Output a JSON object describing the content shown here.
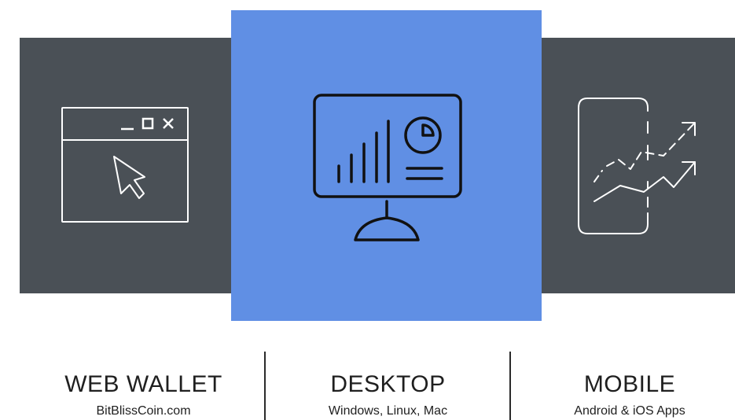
{
  "colors": {
    "dark_panel": "#4a5056",
    "accent_panel": "#608fe4",
    "icon_light": "#ffffff",
    "icon_dark": "#111111",
    "text": "#1f1f1f"
  },
  "platforms": [
    {
      "id": "web",
      "title": "WEB WALLET",
      "subtitle": "BitBlissCoin.com",
      "icon": "browser-window-cursor-icon"
    },
    {
      "id": "desktop",
      "title": "DESKTOP",
      "subtitle": "Windows, Linux, Mac",
      "icon": "monitor-analytics-icon"
    },
    {
      "id": "mobile",
      "title": "MOBILE",
      "subtitle": "Android & iOS Apps",
      "icon": "smartphone-growth-icon"
    }
  ]
}
